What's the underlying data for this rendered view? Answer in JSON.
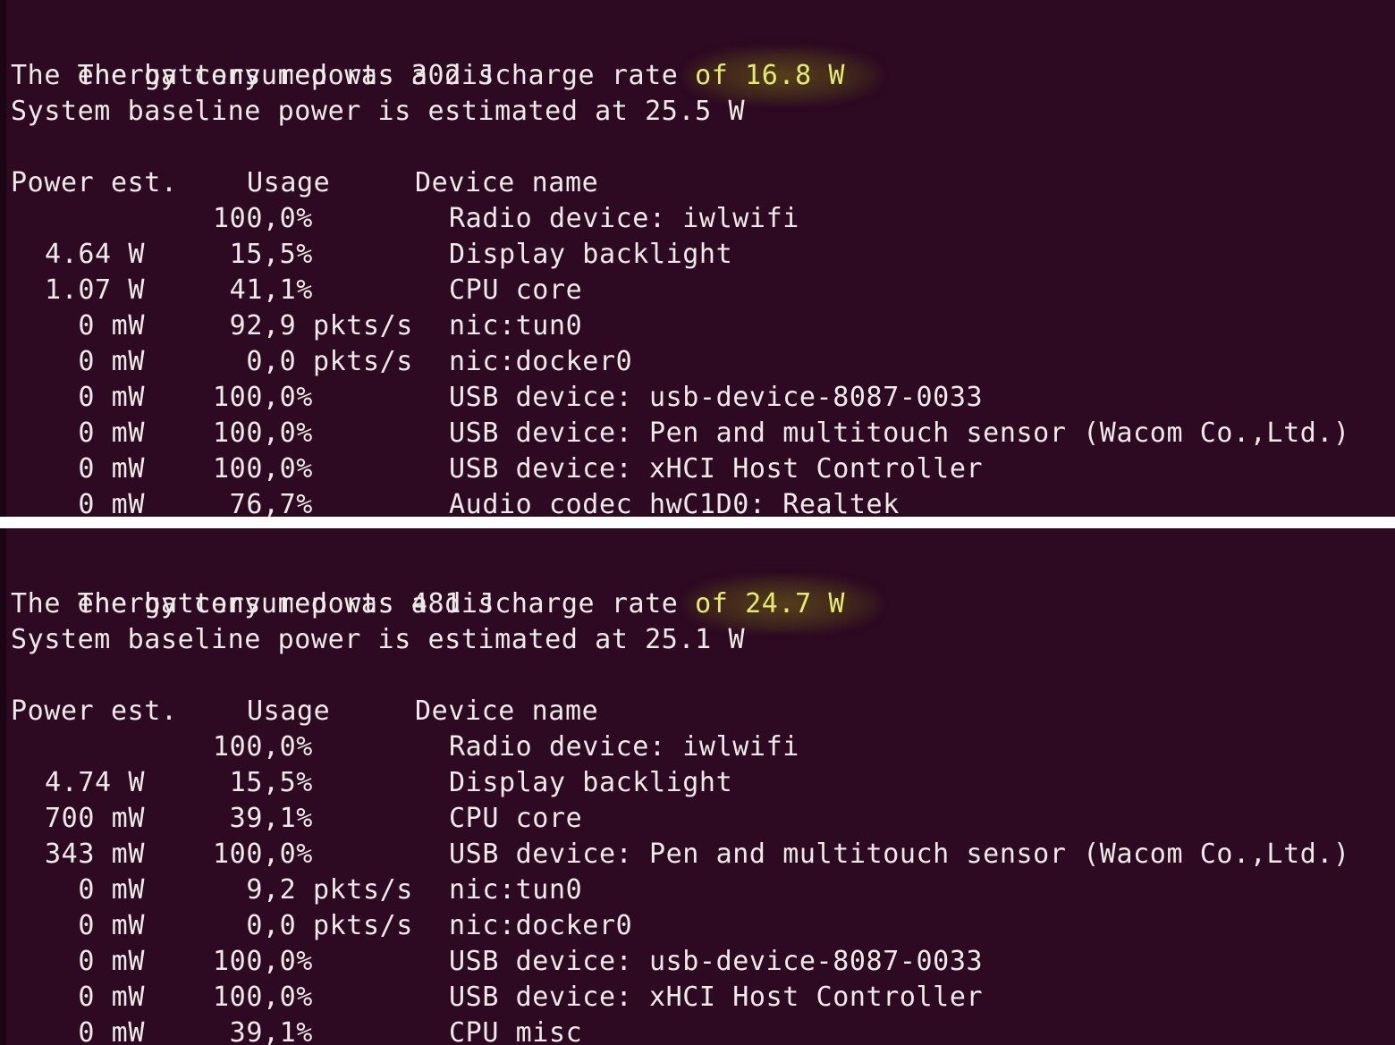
{
  "panels": [
    {
      "summary": {
        "line1_prefix": "The battery reports a discharge rate ",
        "line1_highlight": "of 16.8 W",
        "line2": "The energy consumed was 302 J",
        "line3": "System baseline power is estimated at 25.5 W"
      },
      "columns": [
        "Power est.",
        "Usage",
        "Device name"
      ],
      "rows": [
        {
          "power": "",
          "usage": "100,0%",
          "device": "Radio device: iwlwifi"
        },
        {
          "power": "4.64 W",
          "usage": " 15,5%",
          "device": "Display backlight"
        },
        {
          "power": "1.07 W",
          "usage": " 41,1%",
          "device": "CPU core"
        },
        {
          "power": "0 mW",
          "usage": " 92,9 pkts/s",
          "device": "nic:tun0"
        },
        {
          "power": "0 mW",
          "usage": "  0,0 pkts/s",
          "device": "nic:docker0"
        },
        {
          "power": "0 mW",
          "usage": "100,0%",
          "device": "USB device: usb-device-8087-0033"
        },
        {
          "power": "0 mW",
          "usage": "100,0%",
          "device": "USB device: Pen and multitouch sensor (Wacom Co.,Ltd.)"
        },
        {
          "power": "0 mW",
          "usage": "100,0%",
          "device": "USB device: xHCI Host Controller"
        },
        {
          "power": "0 mW",
          "usage": " 76,7%",
          "device": "Audio codec hwC1D0: Realtek"
        }
      ]
    },
    {
      "summary": {
        "line1_prefix": "The battery reports a discharge rate ",
        "line1_highlight": "of 24.7 W",
        "line2": "The energy consumed was 481 J",
        "line3": "System baseline power is estimated at 25.1 W"
      },
      "columns": [
        "Power est.",
        "Usage",
        "Device name"
      ],
      "rows": [
        {
          "power": "",
          "usage": "100,0%",
          "device": "Radio device: iwlwifi"
        },
        {
          "power": "4.74 W",
          "usage": " 15,5%",
          "device": "Display backlight"
        },
        {
          "power": "700 mW",
          "usage": " 39,1%",
          "device": "CPU core"
        },
        {
          "power": "343 mW",
          "usage": "100,0%",
          "device": "USB device: Pen and multitouch sensor (Wacom Co.,Ltd.)"
        },
        {
          "power": "0 mW",
          "usage": "  9,2 pkts/s",
          "device": "nic:tun0"
        },
        {
          "power": "0 mW",
          "usage": "  0,0 pkts/s",
          "device": "nic:docker0"
        },
        {
          "power": "0 mW",
          "usage": "100,0%",
          "device": "USB device: usb-device-8087-0033"
        },
        {
          "power": "0 mW",
          "usage": "100,0%",
          "device": "USB device: xHCI Host Controller"
        },
        {
          "power": "0 mW",
          "usage": " 39,1%",
          "device": "CPU misc"
        }
      ]
    }
  ],
  "colors": {
    "background": "#2d0922",
    "text": "#ecebe8",
    "highlight_text": "#e5ec6a",
    "separator": "#ffffff"
  }
}
